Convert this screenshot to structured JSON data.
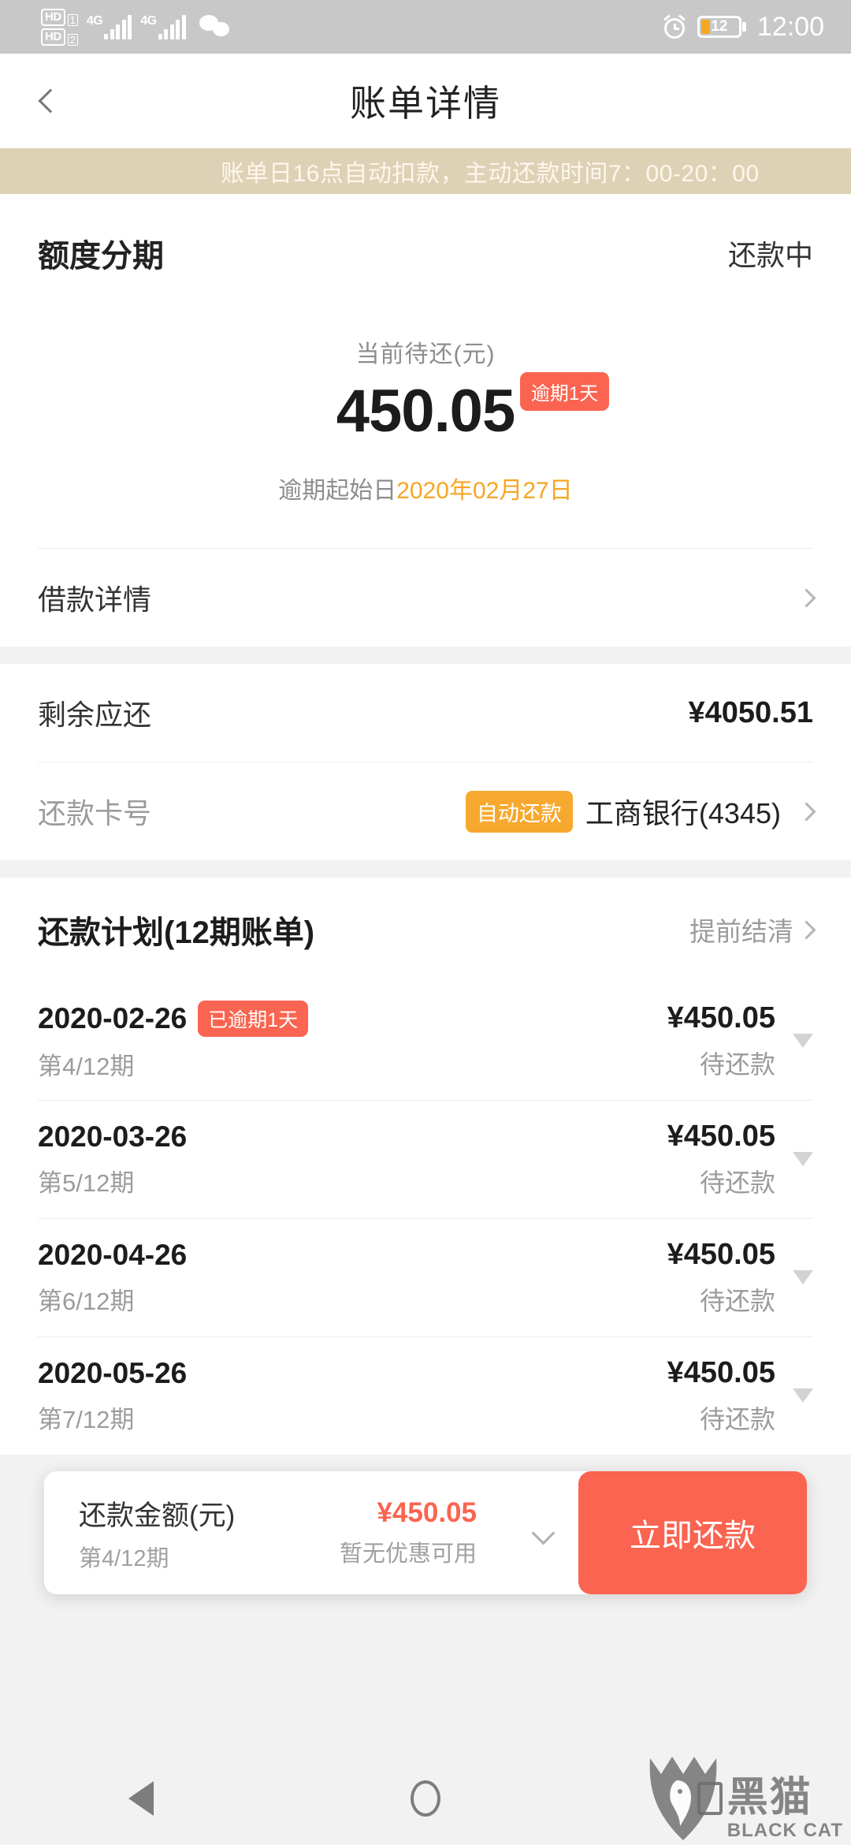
{
  "statusbar": {
    "hd1_label": "HD",
    "hd1_num": "1",
    "hd2_label": "HD",
    "hd2_num": "2",
    "net1": "4G",
    "net2": "4G",
    "wechat_icon": "wechat-icon",
    "alarm_icon": "alarm-icon",
    "battery_percent": "12",
    "time": "12:00"
  },
  "nav": {
    "back_icon": "chevron-left-icon",
    "title": "账单详情"
  },
  "notice": {
    "text": "账单日16点自动扣款，主动还款时间7：00-20：00"
  },
  "summary": {
    "title": "额度分期",
    "status": "还款中",
    "amount_label": "当前待还(元)",
    "amount": "450.05",
    "overdue_badge": "逾期1天",
    "overdue_prefix": "逾期起始日",
    "overdue_date": "2020年02月27日",
    "detail_row_label": "借款详情"
  },
  "info": {
    "remaining_label": "剩余应还",
    "remaining_value": "¥4050.51",
    "card_label": "还款卡号",
    "card_badge": "自动还款",
    "card_value": "工商银行(4345)"
  },
  "plan": {
    "title": "还款计划(12期账单)",
    "link": "提前结清",
    "installments": [
      {
        "date": "2020-02-26",
        "badge": "已逾期1天",
        "term": "第4/12期",
        "amount": "¥450.05",
        "state": "待还款"
      },
      {
        "date": "2020-03-26",
        "badge": "",
        "term": "第5/12期",
        "amount": "¥450.05",
        "state": "待还款"
      },
      {
        "date": "2020-04-26",
        "badge": "",
        "term": "第6/12期",
        "amount": "¥450.05",
        "state": "待还款"
      },
      {
        "date": "2020-05-26",
        "badge": "",
        "term": "第7/12期",
        "amount": "¥450.05",
        "state": "待还款"
      }
    ]
  },
  "paypanel": {
    "amount_label": "还款金额(元)",
    "term": "第4/12期",
    "amount": "¥450.05",
    "coupon": "暂无优惠可用",
    "expand_icon": "chevron-down-icon",
    "button": "立即还款"
  },
  "bottomnav": {
    "back_icon": "triangle-back-icon",
    "home_icon": "circle-home-icon",
    "recent_icon": "square-recents-icon"
  },
  "watermark": {
    "cn": "黑猫",
    "en": "BLACK CAT"
  },
  "colors": {
    "accent_red": "#fa6450",
    "accent_orange": "#f5a623",
    "badge_orange": "#f7a82e",
    "notice_bg": "#ded2b6",
    "page_bg": "#f2f2f2"
  }
}
